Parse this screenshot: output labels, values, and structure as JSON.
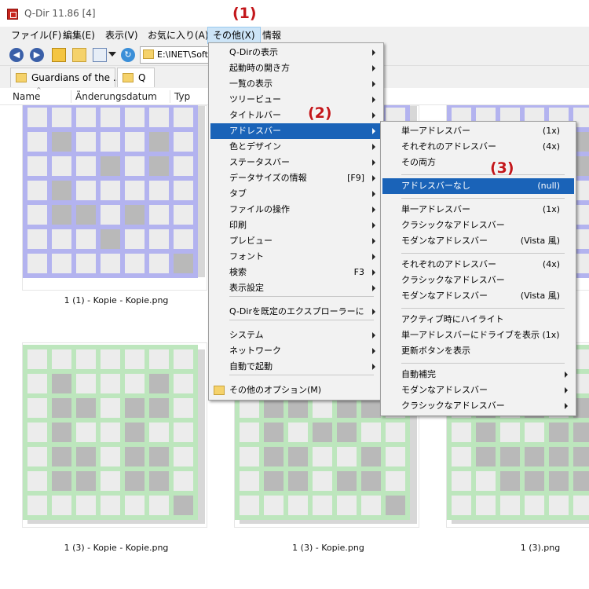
{
  "window": {
    "title": "Q-Dir 11.86 [4]"
  },
  "menubar": {
    "items": [
      "ファイル(F)",
      "編集(E)",
      "表示(V)",
      "お気に入り(A)",
      "その他(X)",
      "情報"
    ]
  },
  "toolbar": {
    "address_text": "E:\\INET\\Soft"
  },
  "tabs": [
    {
      "label": "Guardians of the ..."
    },
    {
      "label": "Q"
    }
  ],
  "columns": [
    "Name",
    "Änderungsdatum",
    "Typ"
  ],
  "files": [
    {
      "caption": "1 (1) - Kopie - Kopie.png",
      "color": "#b3b3ef"
    },
    {
      "caption": "",
      "color": "#b3b3ef"
    },
    {
      "caption": "",
      "color": "#b3b3ef"
    },
    {
      "caption": "1 (3) - Kopie - Kopie.png",
      "color": "#bde6bd"
    },
    {
      "caption": "1 (3) - Kopie.png",
      "color": "#bde6bd"
    },
    {
      "caption": "1 (3).png",
      "color": "#bde6bd"
    }
  ],
  "menu_other": {
    "items": [
      {
        "label": "Q-Dirの表示",
        "arrow": true
      },
      {
        "label": "起動時の開き方",
        "arrow": true
      },
      {
        "label": "一覧の表示",
        "arrow": true
      },
      {
        "label": "ツリービュー",
        "arrow": true
      },
      {
        "label": "タイトルバー",
        "arrow": true
      },
      {
        "label": "アドレスバー",
        "arrow": true
      },
      {
        "label": "色とデザイン",
        "arrow": true
      },
      {
        "label": "ステータスバー",
        "arrow": true
      },
      {
        "label": "データサイズの情報",
        "shortcut": "[F9]",
        "arrow": true
      },
      {
        "label": "タブ",
        "arrow": true
      },
      {
        "label": "ファイルの操作",
        "arrow": true
      },
      {
        "label": "印刷",
        "arrow": true
      },
      {
        "label": "プレビュー",
        "arrow": true
      },
      {
        "label": "フォント",
        "arrow": true
      },
      {
        "label": "検索",
        "shortcut": "F3",
        "arrow": true
      },
      {
        "label": "表示設定",
        "arrow": true
      },
      {
        "label": "Q-Dirを既定のエクスプローラーに",
        "arrow": true
      },
      {
        "label": "システム",
        "arrow": true
      },
      {
        "label": "ネットワーク",
        "arrow": true
      },
      {
        "label": "自動で起動",
        "arrow": true
      },
      {
        "label": "その他のオプション(M)",
        "arrow": false
      }
    ]
  },
  "menu_address": {
    "items": [
      {
        "label": "単一アドレスバー",
        "shortcut": "(1x)"
      },
      {
        "label": "それぞれのアドレスバー",
        "shortcut": "(4x)"
      },
      {
        "label": "その両方",
        "shortcut": ""
      },
      {
        "label": "アドレスバーなし",
        "shortcut": "(null)"
      },
      {
        "label": "単一アドレスバー",
        "shortcut": "(1x)"
      },
      {
        "label": "クラシックなアドレスバー",
        "shortcut": ""
      },
      {
        "label": "モダンなアドレスバー",
        "shortcut": "(Vista 風)"
      },
      {
        "label": "それぞれのアドレスバー",
        "shortcut": "(4x)"
      },
      {
        "label": "クラシックなアドレスバー",
        "shortcut": ""
      },
      {
        "label": "モダンなアドレスバー",
        "shortcut": "(Vista 風)"
      },
      {
        "label": "アクティブ時にハイライト",
        "shortcut": ""
      },
      {
        "label": "単一アドレスバーにドライブを表示 (1x)",
        "shortcut": ""
      },
      {
        "label": "更新ボタンを表示",
        "shortcut": ""
      },
      {
        "label": "自動補完",
        "shortcut": ""
      },
      {
        "label": "モダンなアドレスバー",
        "shortcut": ""
      },
      {
        "label": "クラシックなアドレスバー",
        "shortcut": ""
      }
    ]
  },
  "annotations": [
    "(1)",
    "(2)",
    "(3)"
  ]
}
